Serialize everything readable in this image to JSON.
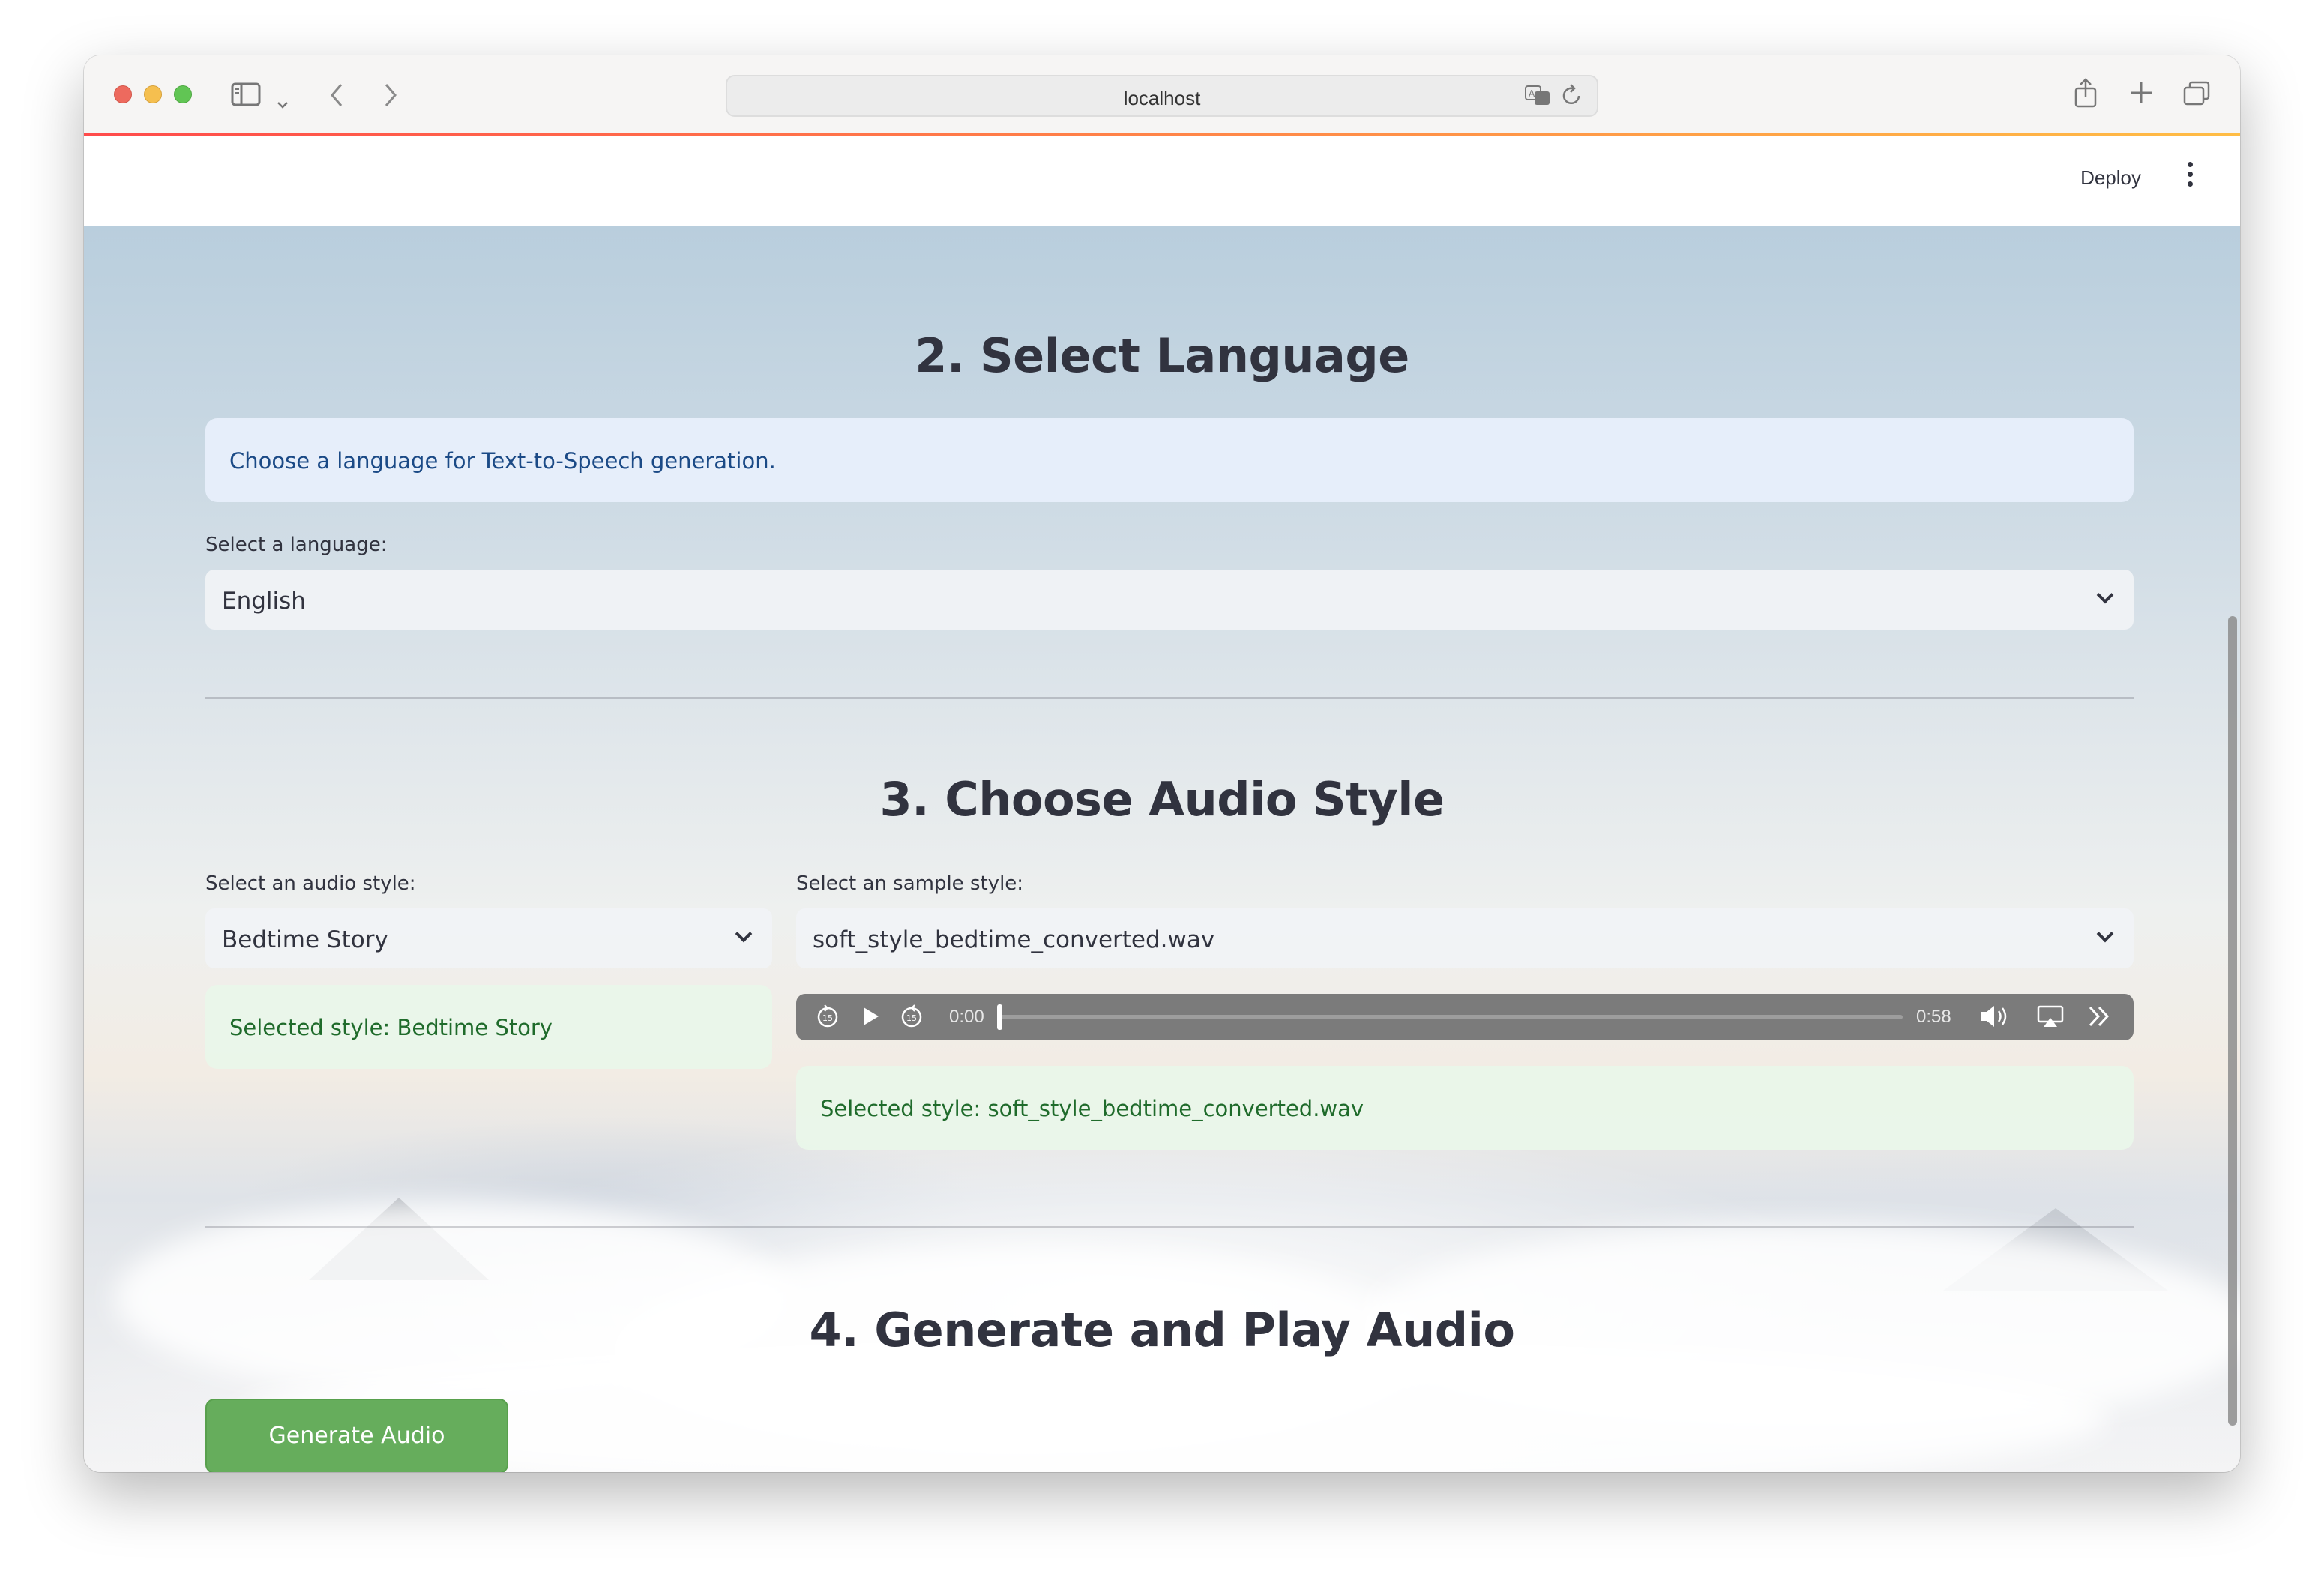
{
  "browser": {
    "address": "localhost"
  },
  "app": {
    "deploy_label": "Deploy"
  },
  "section_language": {
    "title": "2. Select Language",
    "info": "Choose a language for Text-to-Speech generation.",
    "select_label": "Select a language:",
    "selected": "English"
  },
  "section_style": {
    "title": "3. Choose Audio Style",
    "style_label": "Select an audio style:",
    "style_selected": "Bedtime Story",
    "style_success": "Selected style: Bedtime Story",
    "sample_label": "Select an sample style:",
    "sample_selected": "soft_style_bedtime_converted.wav",
    "sample_success": "Selected style: soft_style_bedtime_converted.wav",
    "player": {
      "current_time": "0:00",
      "duration": "0:58",
      "progress": 0
    }
  },
  "section_generate": {
    "title": "4. Generate and Play Audio",
    "button_label": "Generate Audio"
  },
  "colors": {
    "success_bg": "#e9f6ea",
    "info_bg": "#e8f0fc",
    "button": "#66ad5c"
  }
}
